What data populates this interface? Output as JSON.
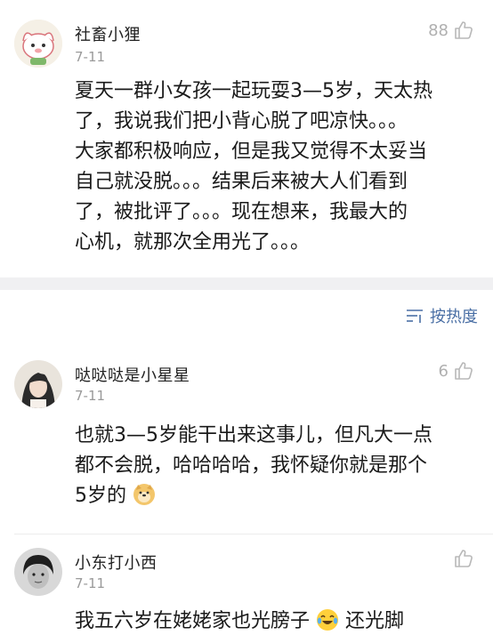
{
  "comments": [
    {
      "name": "社畜小狸",
      "date": "7-11",
      "likes": "88",
      "lines": [
        "夏天一群小女孩一起玩耍3—5岁，天太热",
        "了，我说我们把小背心脱了吧凉快。。。",
        "大家都积极响应，但是我又觉得不太妥当",
        "自己就没脱。。。结果后来被大人们看到",
        "了，被批评了。。。现在想来，我最大的",
        "心机，就那次全用光了。。。"
      ]
    },
    {
      "name": "哒哒哒是小星星",
      "date": "7-11",
      "likes": "6",
      "lines": [
        "也就3—5岁能干出来这事儿，但凡大一点",
        "都不会脱，哈哈哈哈，我怀疑你就是那个",
        "5岁的"
      ]
    },
    {
      "name": "小东打小西",
      "date": "7-11",
      "likes": "",
      "line_a": "我五六岁在姥姥家也光膀子",
      "line_b": "还光脚"
    }
  ],
  "sort_label": "按热度",
  "icons": {
    "like": "thumb-up-icon",
    "sort": "sort-lines-icon",
    "doge": "doge-emoji",
    "laugh": "laugh-cry-emoji"
  },
  "colors": {
    "accent": "#4a6fa5",
    "muted": "#9a9a9a",
    "separator": "#f0f0f2"
  }
}
